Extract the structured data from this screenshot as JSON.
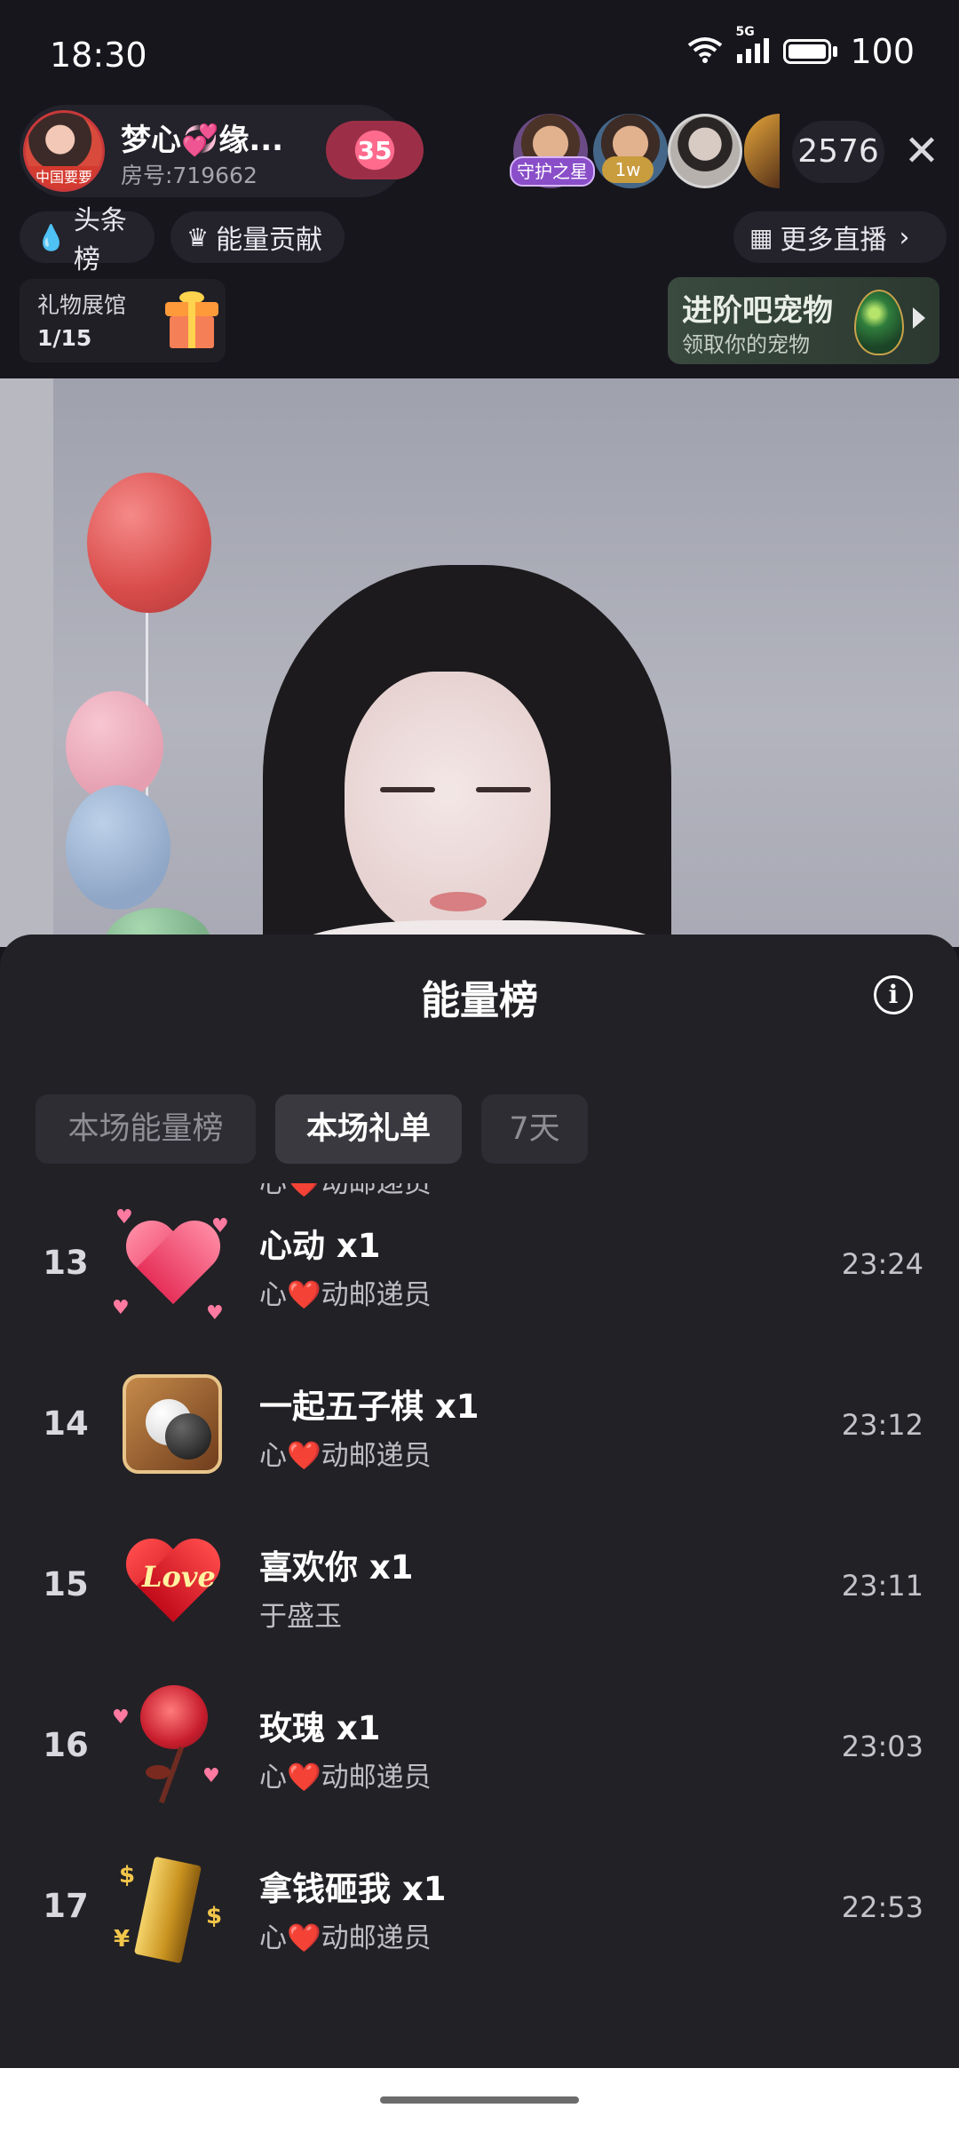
{
  "status_bar": {
    "time": "18:30",
    "network": "5G",
    "battery": "100"
  },
  "host": {
    "name": "梦心💞缘...",
    "room": "房号:719662",
    "avatar_badge": "中国要要",
    "level": "35"
  },
  "viewers": {
    "tag_guard": "守护之星",
    "tag_1w": "1w",
    "count": "2576",
    "close_icon": "close-icon"
  },
  "nav": {
    "headline_rank": "头条榜",
    "energy_contribution": "能量贡献",
    "more_live": "更多直播"
  },
  "gift_hall": {
    "label": "礼物展馆",
    "count": "1/15"
  },
  "pet_banner": {
    "title": "进阶吧宠物",
    "subtitle": "领取你的宠物"
  },
  "sheet": {
    "title": "能量榜",
    "tabs": [
      {
        "label": "本场能量榜",
        "active": false
      },
      {
        "label": "本场礼单",
        "active": true
      },
      {
        "label": "7天",
        "active": false
      }
    ],
    "partial_row": {
      "sender": "心❤️动邮递员"
    },
    "rows": [
      {
        "rank": "13",
        "gift": "心动  x1",
        "sender": "心❤️动邮递员",
        "time": "23:24",
        "icon": "heart-gift-icon"
      },
      {
        "rank": "14",
        "gift": "一起五子棋  x1",
        "sender": "心❤️动邮递员",
        "time": "23:12",
        "icon": "gomoku-gift-icon"
      },
      {
        "rank": "15",
        "gift": "喜欢你  x1",
        "sender": "于盛玉",
        "time": "23:11",
        "icon": "love-heart-gift-icon"
      },
      {
        "rank": "16",
        "gift": "玫瑰  x1",
        "sender": "心❤️动邮递员",
        "time": "23:03",
        "icon": "rose-gift-icon"
      },
      {
        "rank": "17",
        "gift": "拿钱砸我  x1",
        "sender": "心❤️动邮递员",
        "time": "22:53",
        "icon": "gold-bar-gift-icon"
      }
    ]
  },
  "colors": {
    "background": "#17161d",
    "sheet": "#222126",
    "active_tab": "#3a393f"
  }
}
